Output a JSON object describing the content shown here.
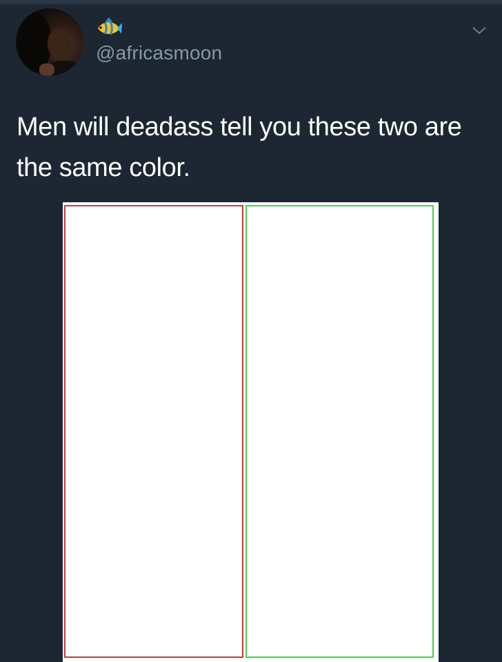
{
  "tweet": {
    "author": {
      "handle": "@africasmoon",
      "name_emoji": "tropical-fish-emoji",
      "avatar": "profile-photo"
    },
    "menu_icon": "chevron-down-icon",
    "text": "Men will deadass tell you these two are the same color.",
    "media": {
      "type": "image",
      "panels": [
        {
          "name": "left-panel",
          "fill": "#ffffff",
          "border": "#c8393b"
        },
        {
          "name": "right-panel",
          "fill": "#ffffff",
          "border": "#3cd83f"
        }
      ]
    }
  },
  "colors": {
    "background": "#1c2733",
    "handle": "#8899a6",
    "text": "#ffffff"
  }
}
